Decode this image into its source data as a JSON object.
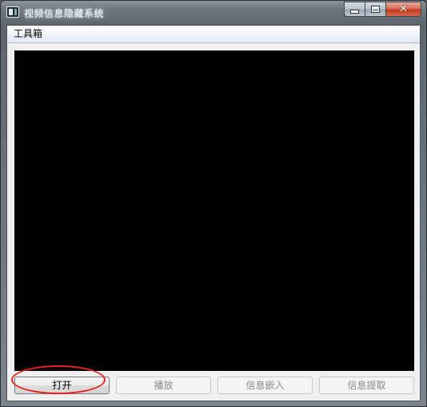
{
  "window": {
    "title": "视频信息隐藏系统",
    "icon": "app-icon",
    "caption_buttons": {
      "minimize_icon": "minimize-icon",
      "maximize_icon": "maximize-icon",
      "close_icon": "close-icon",
      "close_glyph": "✕"
    }
  },
  "menubar": {
    "items": [
      {
        "label": "工具箱"
      }
    ]
  },
  "video": {
    "background": "#000000"
  },
  "buttons": [
    {
      "label": "打开",
      "enabled": true
    },
    {
      "label": "播放",
      "enabled": false
    },
    {
      "label": "信息嵌入",
      "enabled": false
    },
    {
      "label": "信息提取",
      "enabled": false
    }
  ],
  "annotation": {
    "color": "#e8231f",
    "shape": "ellipse",
    "target": "打开"
  }
}
